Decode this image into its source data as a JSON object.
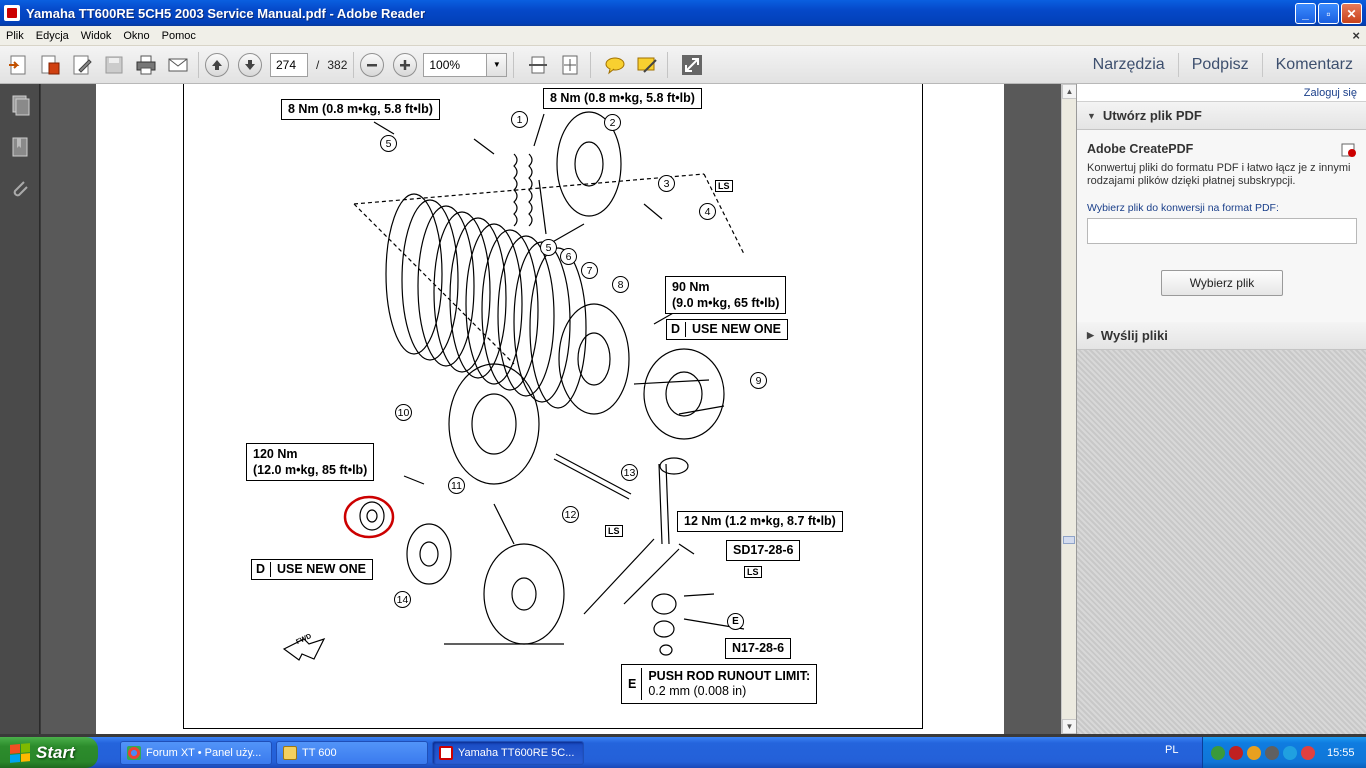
{
  "window": {
    "title": "Yamaha TT600RE 5CH5 2003 Service Manual.pdf - Adobe Reader",
    "btn_minimize": "_",
    "btn_maximize": "▫",
    "btn_close": "✕"
  },
  "menu": {
    "items": [
      "Plik",
      "Edycja",
      "Widok",
      "Okno",
      "Pomoc"
    ],
    "close_glyph": "×"
  },
  "toolbar": {
    "page_current": "274",
    "page_sep": "/",
    "page_total": "382",
    "zoom": "100%",
    "links": [
      "Narzędzia",
      "Podpisz",
      "Komentarz"
    ]
  },
  "diagram": {
    "labels": {
      "torque_top_left": "8 Nm (0.8 m•kg, 5.8 ft•lb)",
      "torque_top_right": "8 Nm (0.8 m•kg, 5.8 ft•lb)",
      "torque_90_line1": "90 Nm",
      "torque_90_line2": "(9.0 m•kg, 65 ft•lb)",
      "use_new_one_right_d": "D",
      "use_new_one_right": "USE NEW ONE",
      "torque_120_line1": "120 Nm",
      "torque_120_line2": "(12.0 m•kg, 85 ft•lb)",
      "use_new_one_left_d": "D",
      "use_new_one_left": "USE NEW ONE",
      "torque_12": "12 Nm (1.2 m•kg, 8.7 ft•lb)",
      "sd_code": "SD17-28-6",
      "n_code": "N17-28-6",
      "runout_e": "E",
      "runout_line1": "PUSH ROD RUNOUT LIMIT:",
      "runout_line2": "0.2 mm (0.008 in)",
      "lub_label": "LS",
      "e_mark": "E",
      "fwd": "FWD"
    },
    "callouts": [
      "1",
      "2",
      "3",
      "4",
      "5",
      "5",
      "6",
      "7",
      "8",
      "9",
      "10",
      "11",
      "12",
      "13",
      "14"
    ]
  },
  "right_panel": {
    "sign_in": "Zaloguj się",
    "section1": "Utwórz plik PDF",
    "createpdf_title": "Adobe CreatePDF",
    "createpdf_desc": "Konwertuj pliki do formatu PDF i łatwo łącz je z innymi rodzajami plików dzięki płatnej subskrypcji.",
    "file_label": "Wybierz plik do konwersji na format PDF:",
    "choose_btn": "Wybierz plik",
    "section2": "Wyślij pliki"
  },
  "taskbar": {
    "start": "Start",
    "tasks": [
      "Forum XT • Panel uży...",
      "TT 600",
      "Yamaha TT600RE 5C..."
    ],
    "lang": "PL",
    "clock": "15:55"
  },
  "colors": {
    "title_blue": "#0548c8",
    "taskbar_blue": "#2464dc",
    "start_green": "#2c8c2c",
    "highlight_red": "#cc0000"
  }
}
